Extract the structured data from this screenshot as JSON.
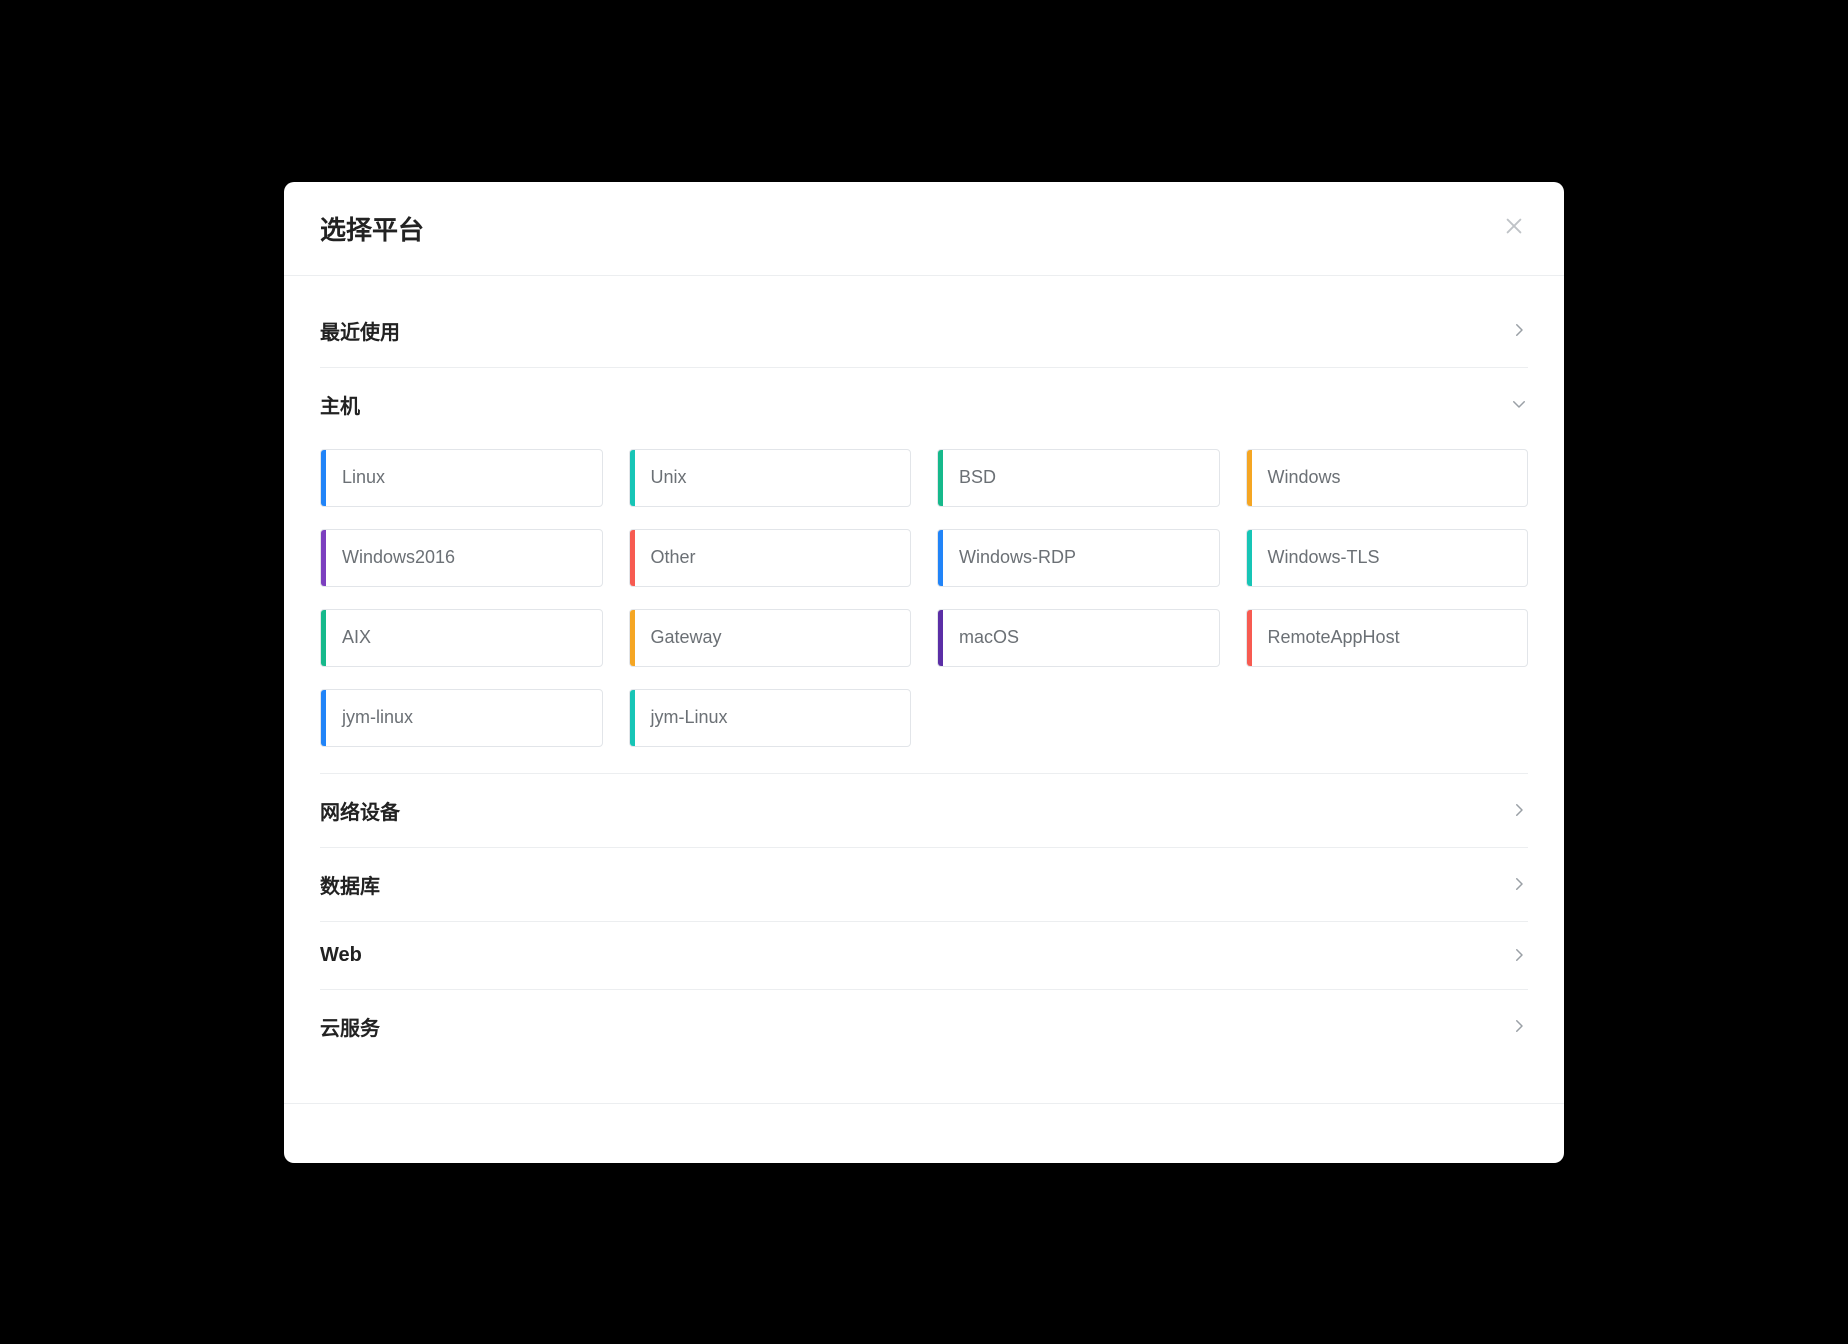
{
  "dialog": {
    "title": "选择平台"
  },
  "sections": [
    {
      "key": "recent",
      "title": "最近使用",
      "expanded": false
    },
    {
      "key": "host",
      "title": "主机",
      "expanded": true,
      "items": [
        {
          "label": "Linux",
          "stripeColor": "#2184f8"
        },
        {
          "label": "Unix",
          "stripeColor": "#17c5b6"
        },
        {
          "label": "BSD",
          "stripeColor": "#16b98b"
        },
        {
          "label": "Windows",
          "stripeColor": "#f5a623"
        },
        {
          "label": "Windows2016",
          "stripeColor": "#7c3fbf"
        },
        {
          "label": "Other",
          "stripeColor": "#f75b51"
        },
        {
          "label": "Windows-RDP",
          "stripeColor": "#2184f8"
        },
        {
          "label": "Windows-TLS",
          "stripeColor": "#17c5b6"
        },
        {
          "label": "AIX",
          "stripeColor": "#16b98b"
        },
        {
          "label": "Gateway",
          "stripeColor": "#f5a623"
        },
        {
          "label": "macOS",
          "stripeColor": "#5b2ea6"
        },
        {
          "label": "RemoteAppHost",
          "stripeColor": "#f75b51"
        },
        {
          "label": "jym-linux",
          "stripeColor": "#2184f8"
        },
        {
          "label": "jym-Linux",
          "stripeColor": "#17c5b6"
        }
      ]
    },
    {
      "key": "network",
      "title": "网络设备",
      "expanded": false
    },
    {
      "key": "database",
      "title": "数据库",
      "expanded": false
    },
    {
      "key": "web",
      "title": "Web",
      "expanded": false
    },
    {
      "key": "cloud",
      "title": "云服务",
      "expanded": false
    }
  ]
}
